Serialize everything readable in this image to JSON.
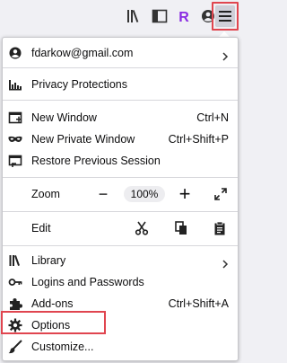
{
  "toolbar": {
    "icons": [
      "library-icon",
      "reader-view-icon",
      "extension-r-icon",
      "account-icon",
      "hamburger-menu-icon"
    ],
    "extension_letter": "R",
    "accent": "#e0454f",
    "extension_color": "#8a2be2"
  },
  "menu": {
    "account": {
      "label": "fdarkow@gmail.com"
    },
    "privacy": {
      "label": "Privacy Protections"
    },
    "new_window": {
      "label": "New Window",
      "shortcut": "Ctrl+N"
    },
    "new_private_window": {
      "label": "New Private Window",
      "shortcut": "Ctrl+Shift+P"
    },
    "restore_session": {
      "label": "Restore Previous Session"
    },
    "zoom": {
      "label": "Zoom",
      "minus": "−",
      "value": "100%",
      "plus": "+"
    },
    "edit": {
      "label": "Edit"
    },
    "library": {
      "label": "Library"
    },
    "logins": {
      "label": "Logins and Passwords"
    },
    "addons": {
      "label": "Add-ons",
      "shortcut": "Ctrl+Shift+A"
    },
    "options": {
      "label": "Options"
    },
    "customize": {
      "label": "Customize..."
    }
  }
}
